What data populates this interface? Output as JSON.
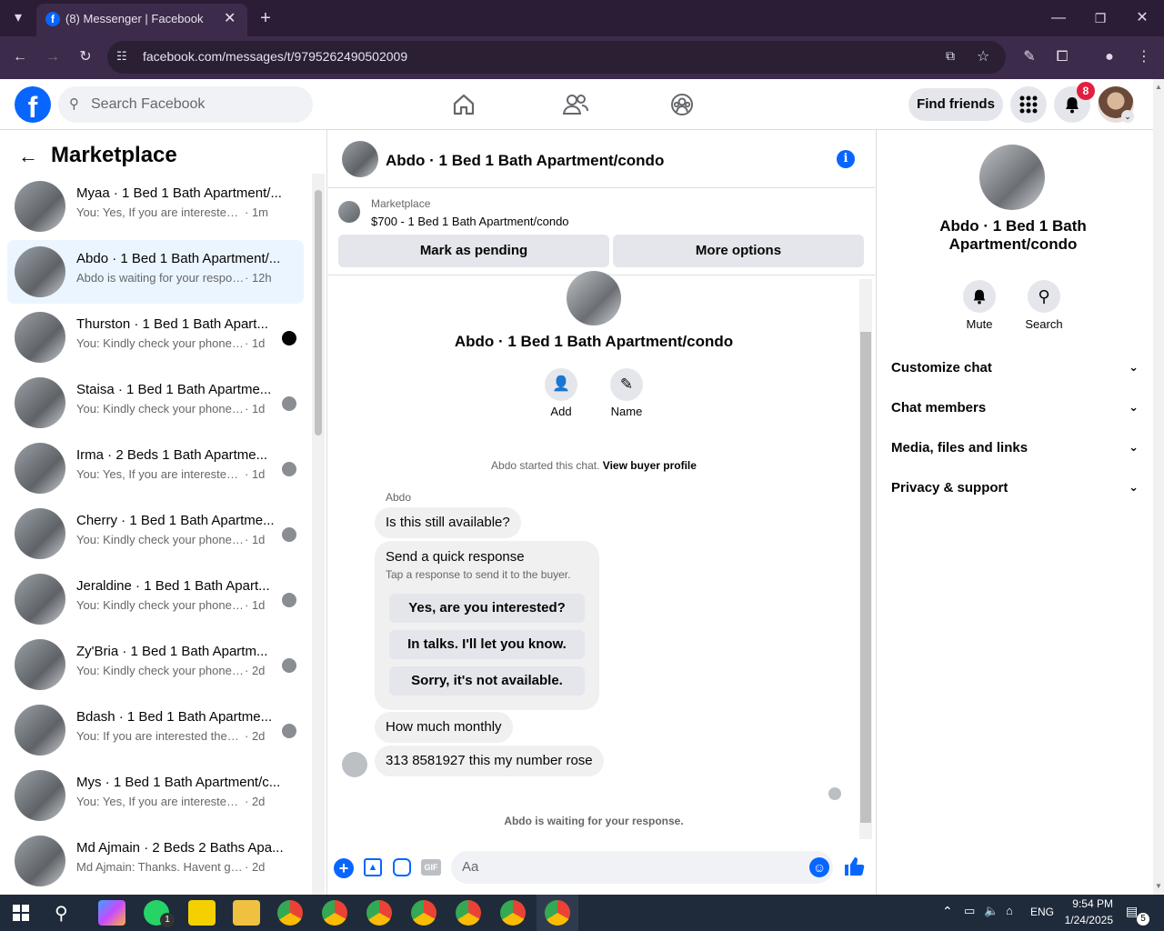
{
  "browser": {
    "tab_title": "(8) Messenger | Facebook",
    "url": "facebook.com/messages/t/9795262490502009"
  },
  "fb_header": {
    "search_placeholder": "Search Facebook",
    "find_friends": "Find friends",
    "notification_count": "8"
  },
  "left_panel": {
    "title": "Marketplace",
    "conversations": [
      {
        "title": "Myaa · 1 Bed 1 Bath Apartment/...",
        "snippet": "You: Yes, If you are interested then...",
        "time": "· 1m",
        "selected": false
      },
      {
        "title": "Abdo · 1 Bed 1 Bath Apartment/...",
        "snippet": "Abdo is waiting for your response.",
        "time": "· 12h",
        "selected": true
      },
      {
        "title": "Thurston · 1 Bed 1 Bath Apart...",
        "snippet": "You: Kindly check your phone a...",
        "time": "· 1d",
        "selected": false
      },
      {
        "title": "Staisa · 1 Bed 1 Bath Apartme...",
        "snippet": "You: Kindly check your phone a...",
        "time": "· 1d",
        "selected": false
      },
      {
        "title": "Irma · 2 Beds 1 Bath Apartme...",
        "snippet": "You: Yes, If you are interested th...",
        "time": "· 1d",
        "selected": false
      },
      {
        "title": "Cherry · 1 Bed 1 Bath Apartme...",
        "snippet": "You: Kindly check your phone a...",
        "time": "· 1d",
        "selected": false
      },
      {
        "title": "Jeraldine · 1 Bed 1 Bath Apart...",
        "snippet": "You: Kindly check your phone a...",
        "time": "· 1d",
        "selected": false
      },
      {
        "title": "Zy'Bria · 1 Bed 1 Bath Apartm...",
        "snippet": "You: Kindly check your phone a...",
        "time": "· 2d",
        "selected": false
      },
      {
        "title": "Bdash · 1 Bed 1 Bath Apartme...",
        "snippet": "You: If you are interested then s...",
        "time": "· 2d",
        "selected": false
      },
      {
        "title": "Mys · 1 Bed 1 Bath Apartment/c...",
        "snippet": "You: Yes, If you are interested then ...",
        "time": "· 2d",
        "selected": false
      },
      {
        "title": "Md Ajmain · 2 Beds 2 Baths Apa...",
        "snippet": "Md Ajmain: Thanks. Havent gotten...",
        "time": "· 2d",
        "selected": false
      }
    ]
  },
  "chat": {
    "header_title": "Abdo · 1 Bed 1 Bath Apartment/condo",
    "listing_label": "Marketplace",
    "listing_price": "$700 - 1 Bed 1 Bath Apartment/condo",
    "mark_pending": "Mark as pending",
    "more_options": "More options",
    "profile_name": "Abdo · 1 Bed 1 Bath Apartment/condo",
    "add_label": "Add",
    "name_label": "Name",
    "started_text": "Abdo started this chat.",
    "view_profile": "View buyer profile",
    "sender": "Abdo",
    "msg1": "Is this still available?",
    "quick_title": "Send a quick response",
    "quick_sub": "Tap a response to send it to the buyer.",
    "quick_replies": [
      "Yes, are you interested?",
      "In talks. I'll let you know.",
      "Sorry, it's not available."
    ],
    "msg2": "How much monthly",
    "msg3": "313 8581927  this my number rose",
    "waiting": "Abdo is waiting for your response.",
    "composer_placeholder": "Aa"
  },
  "right_panel": {
    "name": "Abdo · 1 Bed 1 Bath Apartment/condo",
    "mute": "Mute",
    "search": "Search",
    "sections": [
      "Customize chat",
      "Chat members",
      "Media, files and links",
      "Privacy & support"
    ]
  },
  "taskbar": {
    "whatsapp_badge": "1",
    "lang": "ENG",
    "time": "9:54 PM",
    "date": "1/24/2025",
    "notif_count": "5"
  },
  "colors": {
    "fb_blue": "#0866ff",
    "notif_red": "#e41e3f",
    "selected_bg": "#ebf5ff"
  }
}
